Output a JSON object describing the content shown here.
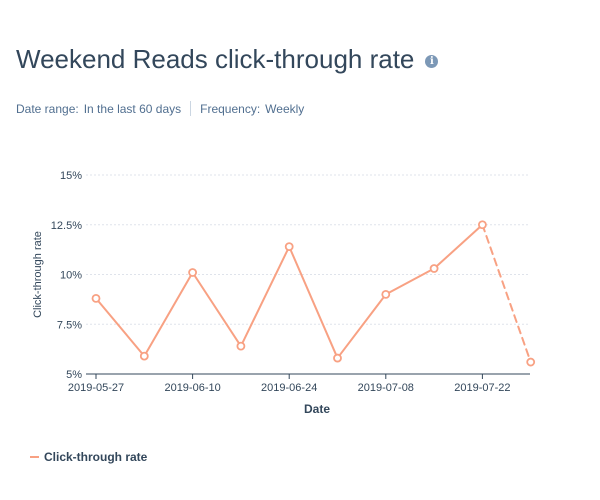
{
  "header": {
    "title": "Weekend Reads click-through rate",
    "info_icon": "info-icon"
  },
  "filters": {
    "date_range_label": "Date range:",
    "date_range_value": "In the last 60 days",
    "frequency_label": "Frequency:",
    "frequency_value": "Weekly"
  },
  "legend": {
    "label": "Click-through rate",
    "color": "#f8a183"
  },
  "colors": {
    "series": "#f8a183",
    "grid": "#dfe3eb",
    "axis": "#33475b",
    "text": "#33475b"
  },
  "chart_data": {
    "type": "line",
    "xlabel": "Date",
    "ylabel": "Click-through rate",
    "ylim": [
      5,
      15
    ],
    "yticks": [
      "5%",
      "7.5%",
      "10%",
      "12.5%",
      "15%"
    ],
    "xticks": [
      "2019-05-27",
      "2019-06-10",
      "2019-06-24",
      "2019-07-08",
      "2019-07-22"
    ],
    "x": [
      "2019-05-27",
      "2019-06-03",
      "2019-06-10",
      "2019-06-17",
      "2019-06-24",
      "2019-07-01",
      "2019-07-08",
      "2019-07-15",
      "2019-07-22",
      "2019-07-29"
    ],
    "series": [
      {
        "name": "Click-through rate",
        "values": [
          8.8,
          5.9,
          10.1,
          6.4,
          11.4,
          5.8,
          9.0,
          10.3,
          12.5,
          5.6
        ],
        "dashed_from_index": 8
      }
    ],
    "grid": true,
    "legend_position": "bottom-left"
  }
}
